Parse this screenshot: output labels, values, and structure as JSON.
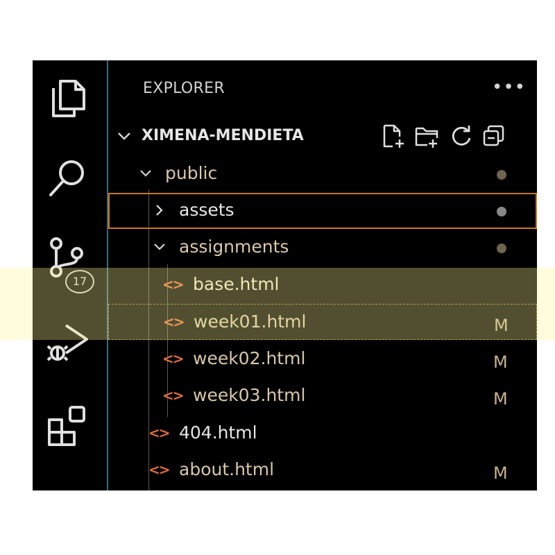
{
  "explorer": {
    "title": "EXPLORER",
    "more_label": "•••"
  },
  "activity_bar": {
    "icons": [
      "files-icon",
      "search-icon",
      "source-control-icon",
      "run-debug-icon",
      "extensions-icon"
    ],
    "source_control_badge": "17"
  },
  "workspace": {
    "name": "XIMENA-MENDIETA",
    "actions": [
      "new-file-icon",
      "new-folder-icon",
      "refresh-icon",
      "collapse-all-icon"
    ]
  },
  "tree": [
    {
      "label": "public",
      "type": "folder",
      "expanded": true,
      "status": "dot"
    },
    {
      "label": "assets",
      "type": "folder",
      "expanded": false,
      "status": "dot",
      "selected": true
    },
    {
      "label": "assignments",
      "type": "folder",
      "expanded": true,
      "status": "dot"
    },
    {
      "label": "base.html",
      "type": "html"
    },
    {
      "label": "week01.html",
      "type": "html",
      "status": "M",
      "focused": true
    },
    {
      "label": "week02.html",
      "type": "html",
      "status": "M"
    },
    {
      "label": "week03.html",
      "type": "html",
      "status": "M"
    },
    {
      "label": "404.html",
      "type": "html"
    },
    {
      "label": "about.html",
      "type": "html",
      "status": "M"
    }
  ],
  "colors": {
    "background": "#000000",
    "html_icon": "#e06c3c",
    "selected_border": "#cc7a1a",
    "modified": "#c8b490",
    "highlight": "#fff596"
  }
}
